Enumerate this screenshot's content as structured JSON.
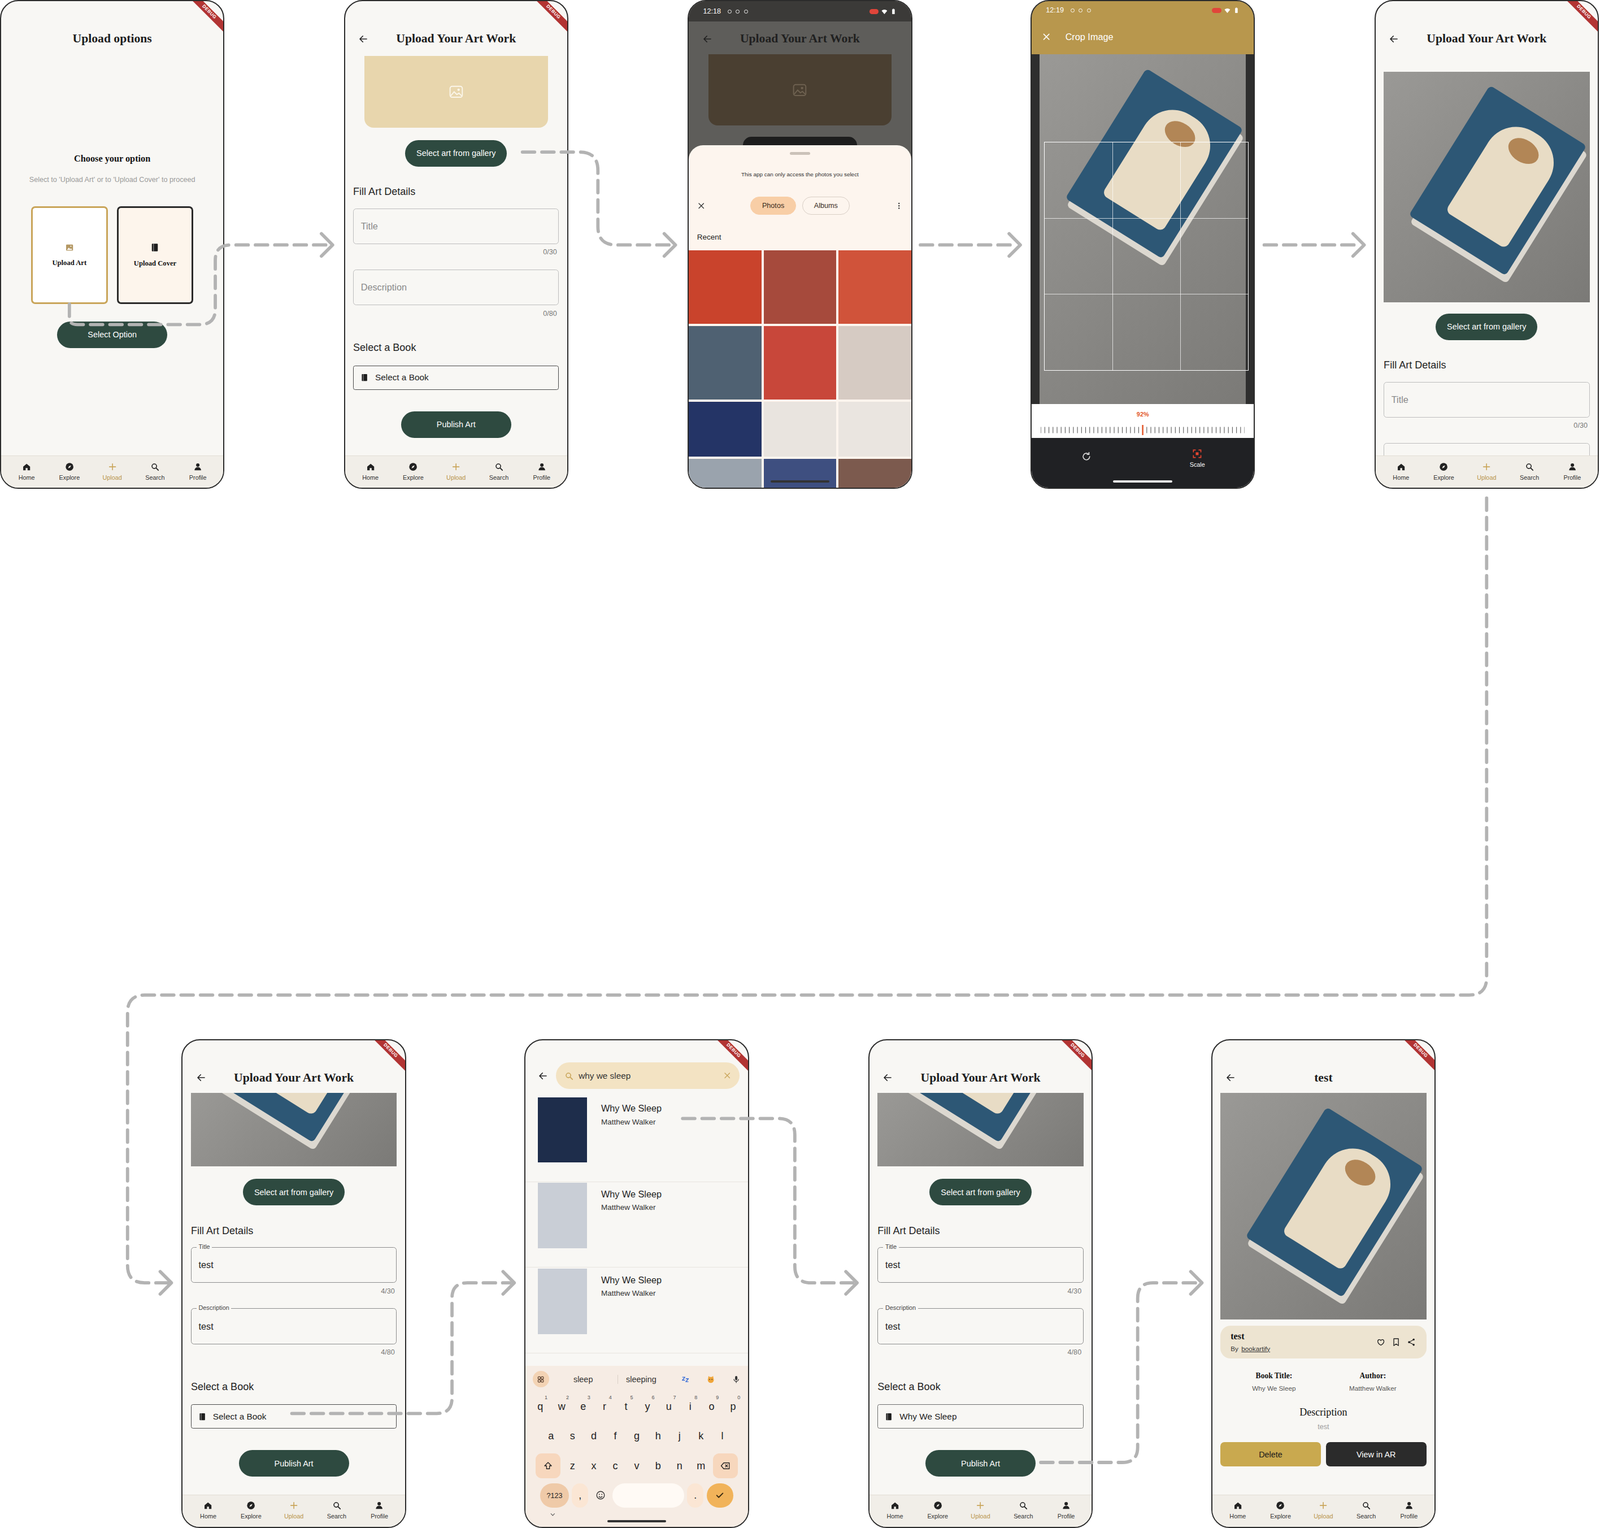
{
  "debug_banner": "DEBUG",
  "nav": [
    {
      "label": "Home",
      "selected": false
    },
    {
      "label": "Explore",
      "selected": false
    },
    {
      "label": "Upload",
      "selected": true
    },
    {
      "label": "Search",
      "selected": false
    },
    {
      "label": "Profile",
      "selected": false
    }
  ],
  "screens": [
    {
      "kind": "options",
      "title": "Upload options",
      "heading": "Choose your option",
      "subtitle": "Select to 'Upload Art' or to 'Upload Cover' to proceed",
      "options": [
        {
          "label": "Upload Art",
          "selected": true
        },
        {
          "label": "Upload Cover",
          "selected": false
        }
      ],
      "button": "Select Option"
    },
    {
      "kind": "form",
      "title": "Upload Your Art Work",
      "image_kind": "placeholder",
      "gallery_button": "Select art from gallery",
      "section": "Fill Art Details",
      "fields": [
        {
          "label": "Title",
          "value": "",
          "counter": "0/30"
        },
        {
          "label": "Description",
          "value": "",
          "counter": "0/80"
        }
      ],
      "book_section": "Select a Book",
      "book": {
        "text": "Select a Book",
        "chosen": false
      },
      "publish": "Publish Art"
    },
    {
      "kind": "picker",
      "time": "12:18",
      "title": "Upload Your Art Work",
      "note": "This app can only access the photos you select",
      "tabs": [
        {
          "label": "Photos",
          "selected": true
        },
        {
          "label": "Albums",
          "selected": false
        }
      ],
      "section": "Recent"
    },
    {
      "kind": "crop",
      "time": "12:19",
      "title": "Crop Image",
      "angle": "92%",
      "tool": "Scale"
    },
    {
      "kind": "form",
      "title": "Upload Your Art Work",
      "image_kind": "photo",
      "gallery_button": "Select art from gallery",
      "section": "Fill Art Details",
      "fields": [
        {
          "label": "Title",
          "value": "",
          "counter": "0/30"
        }
      ]
    },
    {
      "kind": "form",
      "title": "Upload Your Art Work",
      "image_kind": "photo-cropped",
      "gallery_button": "Select art from gallery",
      "section": "Fill Art Details",
      "fields": [
        {
          "label": "Title",
          "value": "test",
          "counter": "4/30"
        },
        {
          "label": "Description",
          "value": "test",
          "counter": "4/80"
        }
      ],
      "book_section": "Select a Book",
      "book": {
        "text": "Select a Book",
        "chosen": false
      },
      "publish": "Publish Art"
    },
    {
      "kind": "search",
      "query": "why we sleep",
      "results": [
        {
          "title": "Why We Sleep",
          "author": "Matthew Walker",
          "faded": false
        },
        {
          "title": "Why We Sleep",
          "author": "Matthew Walker",
          "faded": true
        },
        {
          "title": "Why We Sleep",
          "author": "Matthew Walker",
          "faded": true
        }
      ],
      "keyboard": {
        "suggestions": [
          "sleep",
          "sleeping"
        ],
        "rows": [
          [
            {
              "kind": "letter",
              "label": "q",
              "hint": "1"
            },
            {
              "kind": "letter",
              "label": "w",
              "hint": "2"
            },
            {
              "kind": "letter",
              "label": "e",
              "hint": "3"
            },
            {
              "kind": "letter",
              "label": "r",
              "hint": "4"
            },
            {
              "kind": "letter",
              "label": "t",
              "hint": "5"
            },
            {
              "kind": "letter",
              "label": "y",
              "hint": "6"
            },
            {
              "kind": "letter",
              "label": "u",
              "hint": "7"
            },
            {
              "kind": "letter",
              "label": "i",
              "hint": "8"
            },
            {
              "kind": "letter",
              "label": "o",
              "hint": "9"
            },
            {
              "kind": "letter",
              "label": "p",
              "hint": "0"
            }
          ],
          [
            {
              "kind": "letter",
              "label": "a"
            },
            {
              "kind": "letter",
              "label": "s"
            },
            {
              "kind": "letter",
              "label": "d"
            },
            {
              "kind": "letter",
              "label": "f"
            },
            {
              "kind": "letter",
              "label": "g"
            },
            {
              "kind": "letter",
              "label": "h"
            },
            {
              "kind": "letter",
              "label": "j"
            },
            {
              "kind": "letter",
              "label": "k"
            },
            {
              "kind": "letter",
              "label": "l"
            }
          ],
          [
            {
              "kind": "shift"
            },
            {
              "kind": "letter",
              "label": "z"
            },
            {
              "kind": "letter",
              "label": "x"
            },
            {
              "kind": "letter",
              "label": "c"
            },
            {
              "kind": "letter",
              "label": "v"
            },
            {
              "kind": "letter",
              "label": "b"
            },
            {
              "kind": "letter",
              "label": "n"
            },
            {
              "kind": "letter",
              "label": "m"
            },
            {
              "kind": "backspace"
            }
          ],
          [
            {
              "kind": "symbols",
              "label": "?123"
            },
            {
              "kind": "punct",
              "label": ","
            },
            {
              "kind": "emoji"
            },
            {
              "kind": "space"
            },
            {
              "kind": "punct",
              "label": "."
            },
            {
              "kind": "enter"
            }
          ]
        ]
      }
    },
    {
      "kind": "form",
      "title": "Upload Your Art Work",
      "image_kind": "photo-cropped",
      "gallery_button": "Select art from gallery",
      "section": "Fill Art Details",
      "fields": [
        {
          "label": "Title",
          "value": "test",
          "counter": "4/30"
        },
        {
          "label": "Description",
          "value": "test",
          "counter": "4/80"
        }
      ],
      "book_section": "Select a Book",
      "book": {
        "text": "Why We Sleep",
        "chosen": true
      },
      "publish": "Publish Art"
    },
    {
      "kind": "detail",
      "title": "test",
      "card_title": "test",
      "by": "By",
      "by_link": "bookartify",
      "info": [
        {
          "label": "Book Title:",
          "value": "Why We Sleep"
        },
        {
          "label": "Author:",
          "value": "Matthew Walker"
        }
      ],
      "description_label": "Description",
      "description": "test",
      "buttons": [
        {
          "label": "Delete",
          "kind": "primary"
        },
        {
          "label": "View in AR",
          "kind": "dark"
        }
      ]
    }
  ]
}
